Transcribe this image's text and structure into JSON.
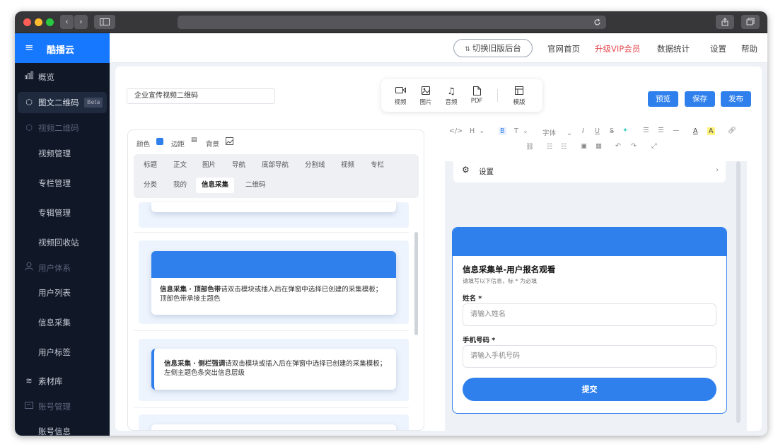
{
  "browser": {
    "window_buttons": [
      "close",
      "minimize",
      "zoom"
    ],
    "nav_back": "‹",
    "nav_forward": "›"
  },
  "brand": {
    "menu_icon": "≡",
    "name": "酷播云"
  },
  "topnav": {
    "switch_label": "切换旧版后台",
    "items": [
      "官网首页",
      "升级VIP会员",
      "数据统计",
      "设置",
      "帮助"
    ],
    "vip_color": "#e5484d"
  },
  "sidebar": {
    "items": [
      {
        "label": "概览",
        "icon": "bar-chart-icon"
      },
      {
        "label": "图文二维码",
        "icon": "cube-icon",
        "badge": "Beta"
      },
      {
        "label": "视频二维码",
        "icon": "cube-icon"
      },
      {
        "label": "视频管理"
      },
      {
        "label": "专栏管理"
      },
      {
        "label": "专辑管理"
      },
      {
        "label": "视频回收站"
      },
      {
        "label": "用户体系",
        "icon": "user-icon"
      },
      {
        "label": "用户列表"
      },
      {
        "label": "信息采集"
      },
      {
        "label": "用户标签"
      },
      {
        "label": "素材库",
        "icon": "layers-icon"
      },
      {
        "label": "账号管理",
        "icon": "id-card-icon"
      },
      {
        "label": "账号信息"
      }
    ]
  },
  "editor": {
    "title_value": "企业宣传视频二维码",
    "insert_tools": [
      {
        "label": "视频",
        "icon": "video-icon"
      },
      {
        "label": "图片",
        "icon": "image-icon"
      },
      {
        "label": "音频",
        "icon": "music-icon"
      },
      {
        "label": "PDF",
        "icon": "file-icon"
      },
      {
        "label": "模版",
        "icon": "template-icon"
      }
    ],
    "actions": {
      "preview": "预览",
      "save": "保存",
      "publish": "发布"
    }
  },
  "panel": {
    "style_controls": {
      "color": "颜色",
      "margin": "边距",
      "background": "背景"
    },
    "tabs_row1": [
      "标题",
      "正文",
      "图片",
      "导航",
      "底部导航",
      "分割线",
      "视频",
      "专栏"
    ],
    "tabs_row2": [
      "分类",
      "我的",
      "信息采集",
      "二维码"
    ],
    "active_tab": "信息采集",
    "templates": [
      {
        "title": "信息采集 · 顶部色带",
        "desc": "请双击模块或插入后在弹窗中选择已创建的采集模板；顶部色带承接主题色"
      },
      {
        "title": "信息采集 · 侧栏强调",
        "desc": "请双击模块或插入后在弹窗中选择已创建的采集模板；左侧主题色条突出信息层级"
      }
    ]
  },
  "richtext": {
    "heading_select": "H",
    "bold": "B",
    "text_label": "T",
    "font_select": "字体",
    "italic": "I",
    "underline": "U",
    "strike": "S",
    "font_color": "A",
    "highlight": "A"
  },
  "preview": {
    "settings_label": "设置",
    "form": {
      "title": "信息采集单-用户报名观看",
      "hint": "请填写以下信息，标 * 为必填",
      "name_label": "姓名 *",
      "name_placeholder": "请输入姓名",
      "phone_label": "手机号码 *",
      "phone_placeholder": "请输入手机号码",
      "submit": "提交"
    },
    "accent": "#2f80ed"
  }
}
